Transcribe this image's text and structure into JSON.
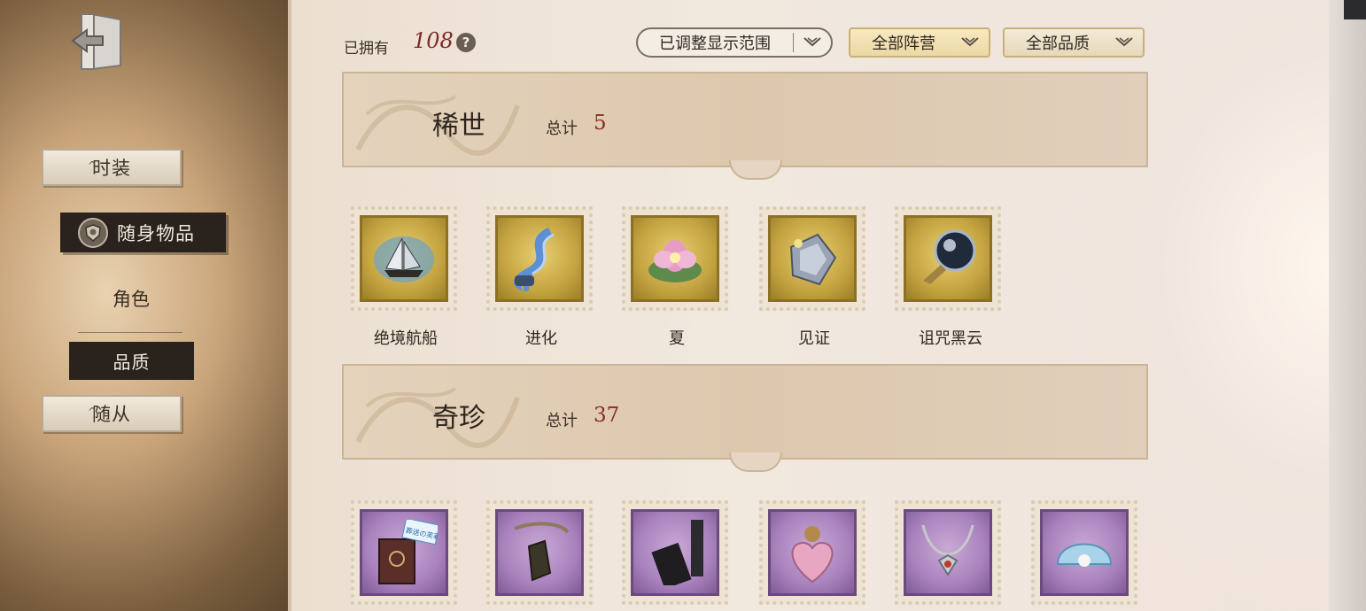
{
  "sidebar": {
    "tab_outfit": "时装",
    "tab_accessory": "随身物品",
    "sub_character": "角色",
    "sub_quality": "品质",
    "tab_follower": "随从"
  },
  "header": {
    "owned_label": "已拥有",
    "owned_count": "108",
    "help_glyph": "?",
    "range_dropdown": "已调整显示范围",
    "faction_dropdown": "全部阵营",
    "quality_dropdown": "全部品质"
  },
  "sections": [
    {
      "title": "稀世",
      "total_label": "总计",
      "total": "5",
      "items": [
        {
          "name": "绝境航船",
          "icon": "ship-icon"
        },
        {
          "name": "进化",
          "icon": "dna-helix-icon"
        },
        {
          "name": "夏",
          "icon": "lotus-icon"
        },
        {
          "name": "见证",
          "icon": "crystal-icon"
        },
        {
          "name": "诅咒黑云",
          "icon": "dark-orb-icon"
        }
      ]
    },
    {
      "title": "奇珍",
      "total_label": "总计",
      "total": "37",
      "items": [
        {
          "name": "",
          "icon": "book-icon",
          "tag": "葬送の芙莉莲"
        },
        {
          "name": "",
          "icon": "pendant-icon"
        },
        {
          "name": "",
          "icon": "phone-icon"
        },
        {
          "name": "",
          "icon": "pink-heart-icon"
        },
        {
          "name": "",
          "icon": "necklace-icon"
        },
        {
          "name": "",
          "icon": "shell-icon"
        }
      ]
    }
  ],
  "colors": {
    "rare_accent": "#c5a441",
    "precious_accent": "#a982bd",
    "total_value": "#8a2b22",
    "owned_count": "#7a2a2a"
  }
}
